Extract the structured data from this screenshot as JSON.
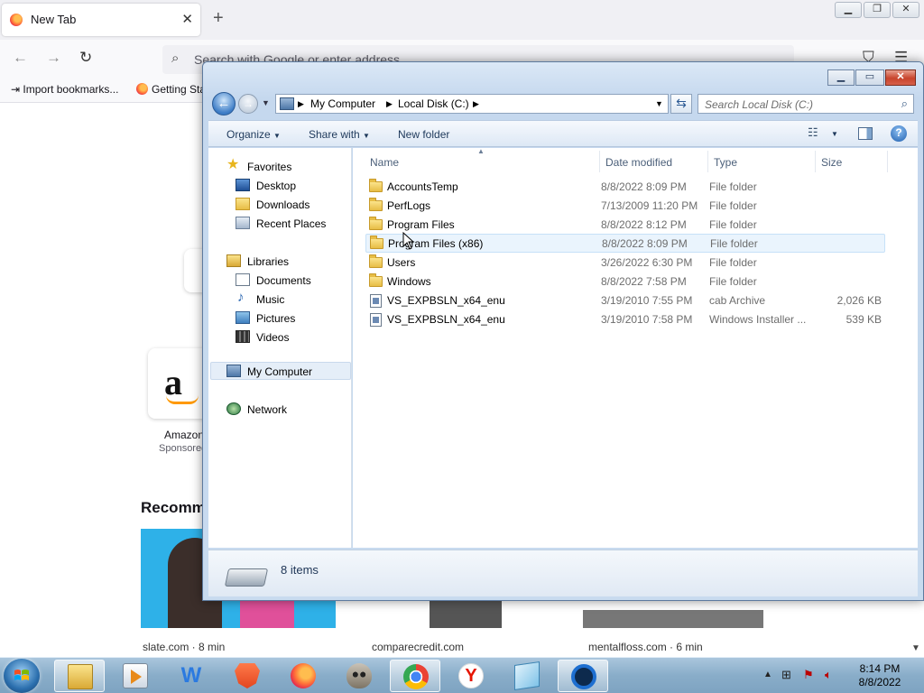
{
  "firefox": {
    "tab_title": "New Tab",
    "new_tab_symbol": "+",
    "tab_close": "✕",
    "url_placeholder": "Search with Google or enter address",
    "bookmarks": [
      "Import bookmarks...",
      "Getting Started"
    ],
    "shortcut": {
      "label": "Amazon",
      "sublabel": "Sponsored"
    },
    "recommended_heading": "Recommended by Pocket",
    "stories": [
      {
        "source": "slate.com · 8 min"
      },
      {
        "source": "comparecredit.com"
      },
      {
        "source": "mentalfloss.com · 6 min"
      }
    ]
  },
  "explorer": {
    "breadcrumb": [
      "My Computer",
      "Local Disk (C:)"
    ],
    "search_placeholder": "Search Local Disk (C:)",
    "toolbar": {
      "organize": "Organize",
      "share_with": "Share with",
      "new_folder": "New folder"
    },
    "nav": {
      "favorites": {
        "label": "Favorites",
        "items": [
          "Desktop",
          "Downloads",
          "Recent Places"
        ]
      },
      "libraries": {
        "label": "Libraries",
        "items": [
          "Documents",
          "Music",
          "Pictures",
          "Videos"
        ]
      },
      "computer": "My Computer",
      "network": "Network"
    },
    "columns": [
      "Name",
      "Date modified",
      "Type",
      "Size"
    ],
    "files": [
      {
        "name": "AccountsTemp",
        "date": "8/8/2022 8:09 PM",
        "type": "File folder",
        "size": "",
        "icon": "folder-icon"
      },
      {
        "name": "PerfLogs",
        "date": "7/13/2009 11:20 PM",
        "type": "File folder",
        "size": "",
        "icon": "folder-icon"
      },
      {
        "name": "Program Files",
        "date": "8/8/2022 8:12 PM",
        "type": "File folder",
        "size": "",
        "icon": "folder-icon"
      },
      {
        "name": "Program Files (x86)",
        "date": "8/8/2022 8:09 PM",
        "type": "File folder",
        "size": "",
        "icon": "folder-icon"
      },
      {
        "name": "Users",
        "date": "3/26/2022 6:30 PM",
        "type": "File folder",
        "size": "",
        "icon": "folder-icon"
      },
      {
        "name": "Windows",
        "date": "8/8/2022 7:58 PM",
        "type": "File folder",
        "size": "",
        "icon": "folder-icon"
      },
      {
        "name": "VS_EXPBSLN_x64_enu",
        "date": "3/19/2010 7:55 PM",
        "type": "cab Archive",
        "size": "2,026 KB",
        "icon": "cab-file-icon"
      },
      {
        "name": "VS_EXPBSLN_x64_enu",
        "date": "3/19/2010 7:58 PM",
        "type": "Windows Installer ...",
        "size": "539 KB",
        "icon": "installer-file-icon"
      }
    ],
    "status_count": "8 items"
  },
  "taskbar": {
    "apps": [
      "explorer-icon",
      "media-player-icon",
      "wps-icon",
      "brave-icon",
      "firefox-icon",
      "raccoon-app-icon",
      "chrome-icon",
      "yandex-icon",
      "notepad-icon",
      "circle-app-icon"
    ],
    "time": "8:14 PM",
    "date": "8/8/2022"
  }
}
